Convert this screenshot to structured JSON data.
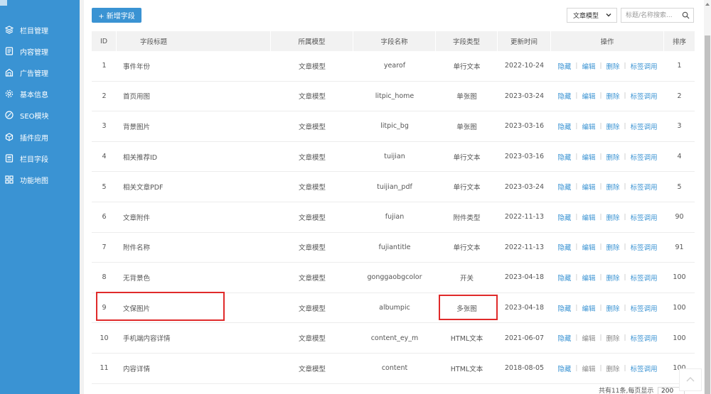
{
  "sidebar": {
    "items": [
      {
        "label": "栏目管理",
        "icon": "layers-icon"
      },
      {
        "label": "内容管理",
        "icon": "document-icon"
      },
      {
        "label": "广告管理",
        "icon": "ad-icon"
      },
      {
        "label": "基本信息",
        "icon": "gear-icon"
      },
      {
        "label": "SEO模块",
        "icon": "seo-icon"
      },
      {
        "label": "插件应用",
        "icon": "plugin-icon"
      },
      {
        "label": "栏目字段",
        "icon": "field-icon"
      },
      {
        "label": "功能地图",
        "icon": "grid-icon"
      }
    ]
  },
  "toolbar": {
    "add_label": "+ 新增字段",
    "model_filter": "文章模型",
    "search_placeholder": "标题/名称搜索...",
    "search_icon": "search-icon"
  },
  "table": {
    "headers": [
      "ID",
      "字段标题",
      "所属模型",
      "字段名称",
      "字段类型",
      "更新时间",
      "操作",
      "排序"
    ],
    "op_labels": {
      "hide": "隐藏",
      "edit": "编辑",
      "delete": "删除",
      "tag": "标签调用"
    },
    "rows": [
      {
        "id": "1",
        "title": "事件年份",
        "model": "文章模型",
        "field": "yearof",
        "type": "单行文本",
        "time": "2022-10-24",
        "sort": "1"
      },
      {
        "id": "2",
        "title": "首页用图",
        "model": "文章模型",
        "field": "litpic_home",
        "type": "单张图",
        "time": "2023-03-24",
        "sort": "2"
      },
      {
        "id": "3",
        "title": "背景图片",
        "model": "文章模型",
        "field": "litpic_bg",
        "type": "单张图",
        "time": "2023-03-16",
        "sort": "3"
      },
      {
        "id": "4",
        "title": "相关推荐ID",
        "model": "文章模型",
        "field": "tuijian",
        "type": "单行文本",
        "time": "2023-03-16",
        "sort": "4"
      },
      {
        "id": "5",
        "title": "相关文章PDF",
        "model": "文章模型",
        "field": "tuijian_pdf",
        "type": "单行文本",
        "time": "2023-03-24",
        "sort": "5"
      },
      {
        "id": "6",
        "title": "文章附件",
        "model": "文章模型",
        "field": "fujian",
        "type": "附件类型",
        "time": "2022-11-13",
        "sort": "90"
      },
      {
        "id": "7",
        "title": "附件名称",
        "model": "文章模型",
        "field": "fujiantitle",
        "type": "单行文本",
        "time": "2022-11-13",
        "sort": "91"
      },
      {
        "id": "8",
        "title": "无背景色",
        "model": "文章模型",
        "field": "gonggaobgcolor",
        "type": "开关",
        "time": "2023-04-18",
        "sort": "100"
      },
      {
        "id": "9",
        "title": "文保图片",
        "model": "文章模型",
        "field": "albumpic",
        "type": "多张图",
        "time": "2023-04-18",
        "sort": "100"
      },
      {
        "id": "10",
        "title": "手机端内容详情",
        "model": "文章模型",
        "field": "content_ey_m",
        "type": "HTML文本",
        "time": "2021-06-07",
        "sort": "100"
      },
      {
        "id": "11",
        "title": "内容详情",
        "model": "文章模型",
        "field": "content",
        "type": "HTML文本",
        "time": "2018-08-05",
        "sort": "100"
      }
    ]
  },
  "footer": {
    "summary": "共有11条,每页显示",
    "page_size": "200"
  },
  "colors": {
    "sidebar_bg": "#3a93d3",
    "accent": "#3a93d3",
    "highlight": "#e02a2a"
  }
}
